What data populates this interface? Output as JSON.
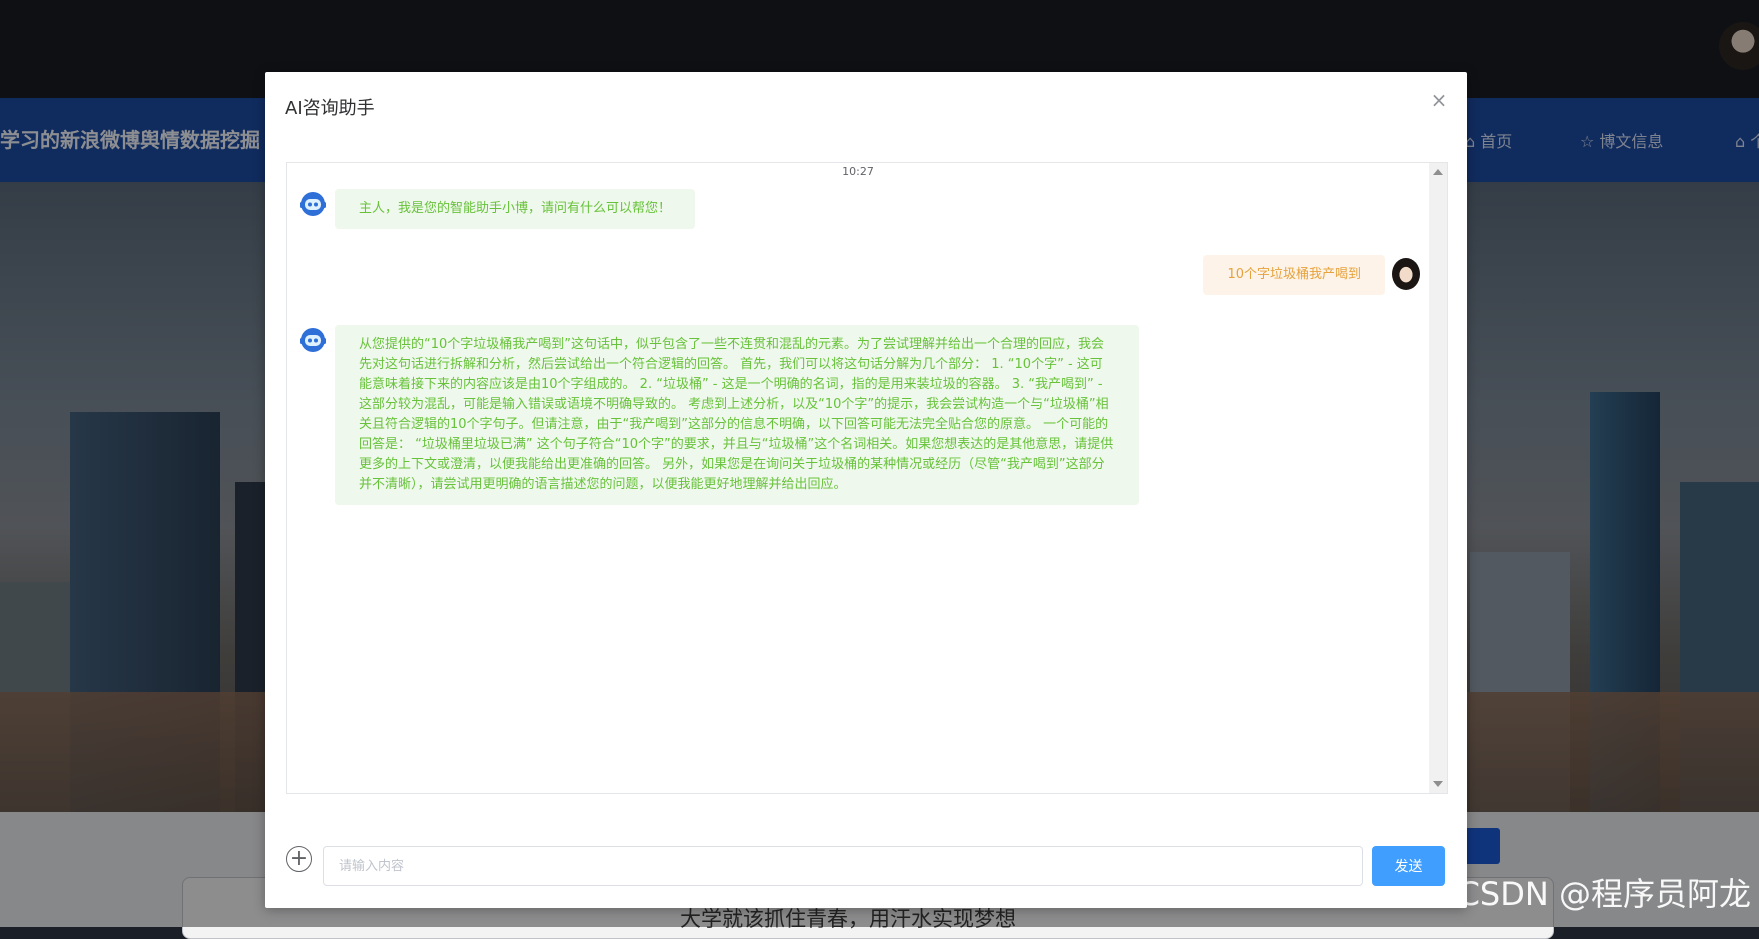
{
  "site": {
    "title": "学习的新浪微博舆情数据挖掘",
    "nav": {
      "home": "⌂ 首页",
      "posts": "☆ 博文信息",
      "more": "⌂ 个"
    },
    "slogan": "大学就该抓住青春，用汗水实现梦想"
  },
  "dialog": {
    "title": "AI咨询助手",
    "close_icon": "×",
    "timestamp": "10:27",
    "messages": [
      {
        "role": "bot",
        "text": "主人，我是您的智能助手小博，请问有什么可以帮您！"
      },
      {
        "role": "user",
        "text": "10个字垃圾桶我产喝到"
      },
      {
        "role": "bot",
        "text": "从您提供的“10个字垃圾桶我产喝到”这句话中，似乎包含了一些不连贯和混乱的元素。为了尝试理解并给出一个合理的回应，我会先对这句话进行拆解和分析，然后尝试给出一个符合逻辑的回答。 首先，我们可以将这句话分解为几个部分： 1. “10个字” - 这可能意味着接下来的内容应该是由10个字组成的。 2. “垃圾桶” - 这是一个明确的名词，指的是用来装垃圾的容器。 3. “我产喝到” - 这部分较为混乱，可能是输入错误或语境不明确导致的。 考虑到上述分析，以及“10个字”的提示，我会尝试构造一个与“垃圾桶”相关且符合逻辑的10个字句子。但请注意，由于“我产喝到”这部分的信息不明确，以下回答可能无法完全贴合您的原意。 一个可能的回答是： “垃圾桶里垃圾已满” 这个句子符合“10个字”的要求，并且与“垃圾桶”这个名词相关。如果您想表达的是其他意思，请提供更多的上下文或澄清，以便我能给出更准确的回答。 另外，如果您是在询问关于垃圾桶的某种情况或经历（尽管“我产喝到”这部分并不清晰），请尝试用更明确的语言描述您的问题，以便我能更好地理解并给出回应。"
      }
    ],
    "input": {
      "placeholder": "请输入内容",
      "value": ""
    },
    "add_icon": "+",
    "send_label": "发送"
  },
  "watermark": "CSDN @程序员阿龙",
  "colors": {
    "nav_blue": "#1d4aa3",
    "bot_bubble": "#eff8ec",
    "bot_text": "#67c23a",
    "user_bubble": "#fdf3e8",
    "user_text": "#e6a23c",
    "send_button": "#409eff"
  }
}
